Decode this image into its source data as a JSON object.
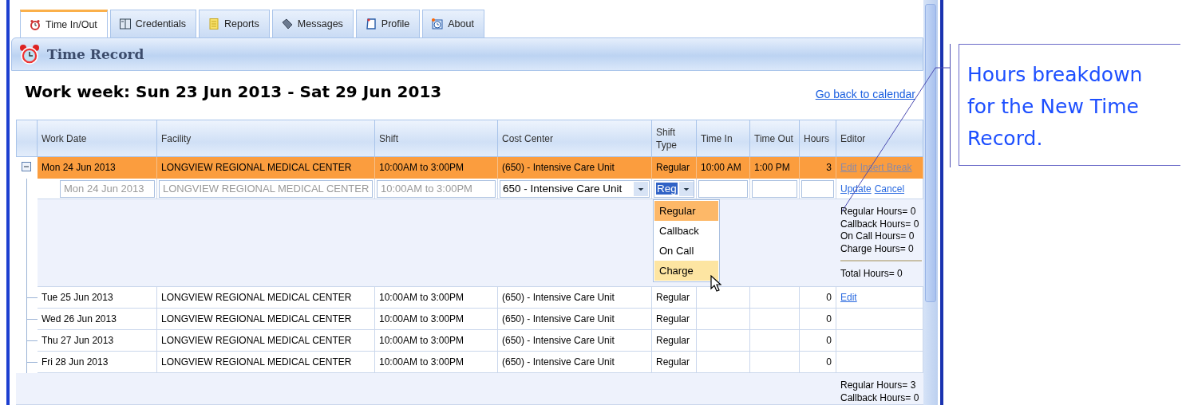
{
  "tabs": [
    {
      "label": "Time In/Out",
      "selected": true
    },
    {
      "label": "Credentials",
      "selected": false
    },
    {
      "label": "Reports",
      "selected": false
    },
    {
      "label": "Messages",
      "selected": false
    },
    {
      "label": "Profile",
      "selected": false
    },
    {
      "label": "About",
      "selected": false
    }
  ],
  "panel": {
    "title": "Time Record"
  },
  "heading": "Work week: Sun 23 Jun 2013 - Sat 29 Jun 2013",
  "back_link": "Go back to calendar",
  "table": {
    "columns": [
      "Work Date",
      "Facility",
      "Shift",
      "Cost Center",
      "Shift Type",
      "Time In",
      "Time Out",
      "Hours",
      "Editor"
    ],
    "rows": [
      {
        "selected": true,
        "expanded": true,
        "work_date": "Mon 24 Jun 2013",
        "facility": "LONGVIEW REGIONAL MEDICAL CENTER",
        "shift": "10:00AM to 3:00PM",
        "cost_center": "(650) - Intensive Care Unit",
        "shift_type": "Regular",
        "time_in": "10:00 AM",
        "time_out": "1:00 PM",
        "hours": "3",
        "links": [
          "Edit",
          "Insert Break"
        ]
      },
      {
        "selected": false,
        "work_date": "Tue 25 Jun 2013",
        "facility": "LONGVIEW REGIONAL MEDICAL CENTER",
        "shift": "10:00AM to 3:00PM",
        "cost_center": "(650) - Intensive Care Unit",
        "shift_type": "Regular",
        "hours": "0",
        "links": [
          "Edit"
        ]
      },
      {
        "selected": false,
        "work_date": "Wed 26 Jun 2013",
        "facility": "LONGVIEW REGIONAL MEDICAL CENTER",
        "shift": "10:00AM to 3:00PM",
        "cost_center": "(650) - Intensive Care Unit",
        "shift_type": "Regular",
        "hours": "0"
      },
      {
        "selected": false,
        "work_date": "Thu 27 Jun 2013",
        "facility": "LONGVIEW REGIONAL MEDICAL CENTER",
        "shift": "10:00AM to 3:00PM",
        "cost_center": "(650) - Intensive Care Unit",
        "shift_type": "Regular",
        "hours": "0"
      },
      {
        "selected": false,
        "work_date": "Fri 28 Jun 2013",
        "facility": "LONGVIEW REGIONAL MEDICAL CENTER",
        "shift": "10:00AM to 3:00PM",
        "cost_center": "(650) - Intensive Care Unit",
        "shift_type": "Regular",
        "hours": "0"
      }
    ]
  },
  "edit_form": {
    "locked_fields": [
      {
        "value": "Mon 24 Jun 2013",
        "disabled": true
      },
      {
        "value": "LONGVIEW REGIONAL MEDICAL CENTER",
        "disabled": true
      },
      {
        "value": "10:00AM to  3:00PM",
        "disabled": true
      }
    ],
    "cost_center": "650 - Intensive Care Unit",
    "shift_type": "Reg",
    "links": [
      "Update",
      "Cancel"
    ],
    "dropdown": {
      "open": true,
      "options": [
        {
          "label": "Regular",
          "selected": true,
          "hovered": false
        },
        {
          "label": "Callback",
          "selected": false,
          "hovered": false
        },
        {
          "label": "On Call",
          "selected": false,
          "hovered": false
        },
        {
          "label": "Charge",
          "selected": false,
          "hovered": true
        }
      ]
    },
    "breakdown": {
      "lines": [
        "Regular Hours= 0",
        "Callback Hours= 0",
        "On Call Hours= 0",
        "Charge Hours= 0"
      ],
      "total": "Total Hours= 0"
    }
  },
  "summary": {
    "lines": [
      "Regular Hours= 3",
      "Callback Hours= 0"
    ]
  },
  "callout": {
    "text": "Hours breakdown for the New Time Record."
  }
}
